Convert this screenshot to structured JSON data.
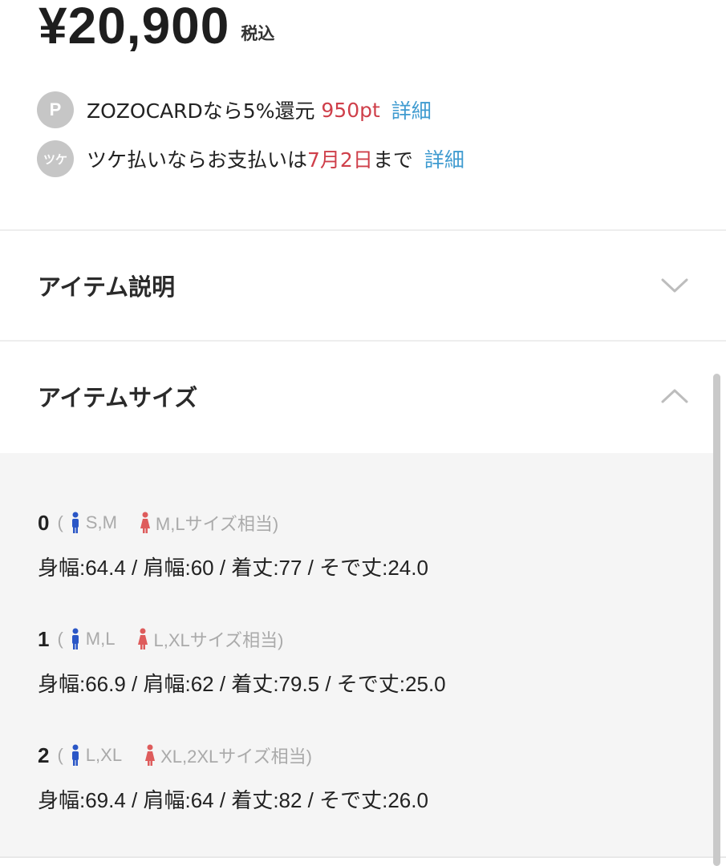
{
  "price": {
    "amount": "¥20,900",
    "tax_label": "税込"
  },
  "perks": [
    {
      "icon": "P",
      "text_before": "ZOZOCARDなら5%還元 ",
      "highlight": "950pt",
      "text_after": "",
      "link": "詳細"
    },
    {
      "icon": "ツケ",
      "text_before": "ツケ払いならお支払いは",
      "highlight": "7月2日",
      "text_after": "まで",
      "link": "詳細"
    }
  ],
  "sections": {
    "description": {
      "title": "アイテム説明",
      "state": "collapsed"
    },
    "size": {
      "title": "アイテムサイズ",
      "state": "expanded"
    }
  },
  "sizes": [
    {
      "num": "0",
      "open": "(",
      "men": "S,M",
      "women": "M,Lサイズ相当)",
      "measure": "身幅:64.4 / 肩幅:60 / 着丈:77 / そで丈:24.0"
    },
    {
      "num": "1",
      "open": "(",
      "men": "M,L",
      "women": "L,XLサイズ相当)",
      "measure": "身幅:66.9 / 肩幅:62 / 着丈:79.5 / そで丈:25.0"
    },
    {
      "num": "2",
      "open": "(",
      "men": "L,XL",
      "women": "XL,2XLサイズ相当)",
      "measure": "身幅:69.4 / 肩幅:64 / 着丈:82 / そで丈:26.0"
    }
  ],
  "colors": {
    "accent_red": "#cf3f4a",
    "link_blue": "#3f9bd0",
    "men_icon": "#2a56c6",
    "women_icon": "#de5c5c"
  }
}
